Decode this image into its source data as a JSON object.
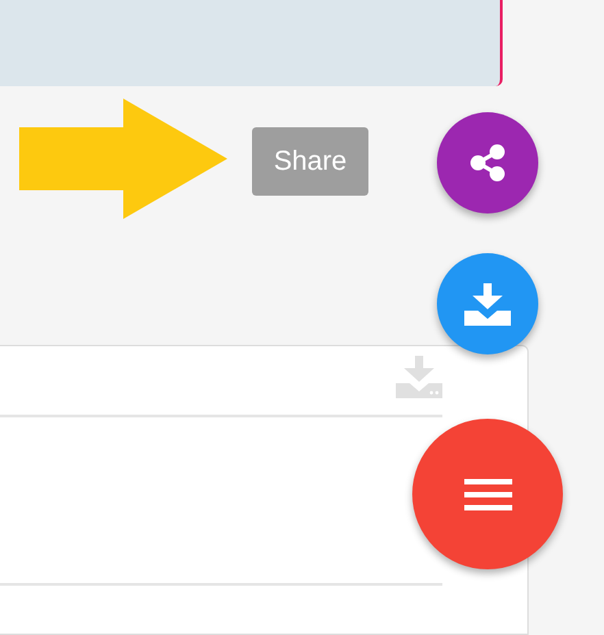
{
  "tooltip": {
    "label": "Share"
  },
  "fabs": [
    {
      "kind": "share"
    },
    {
      "kind": "download"
    },
    {
      "kind": "menu"
    }
  ]
}
